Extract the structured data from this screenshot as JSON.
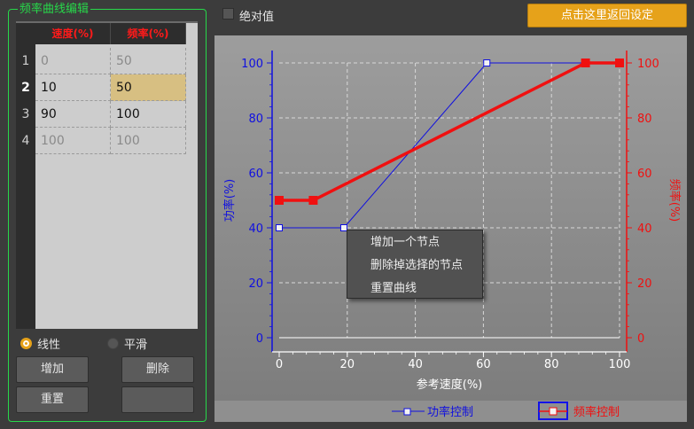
{
  "editor": {
    "group_title": "频率曲线编辑",
    "columns": [
      "速度(%)",
      "频率(%)"
    ],
    "rows": [
      {
        "index": "1",
        "speed": "0",
        "freq": "50"
      },
      {
        "index": "2",
        "speed": "10",
        "freq": "50"
      },
      {
        "index": "3",
        "speed": "90",
        "freq": "100"
      },
      {
        "index": "4",
        "speed": "100",
        "freq": "100"
      }
    ],
    "selected_row": 2,
    "radio_linear": "线性",
    "radio_smooth": "平滑",
    "selected_mode": "线性",
    "btn_add": "增加",
    "btn_delete": "删除",
    "btn_reset": "重置",
    "btn_blank": ""
  },
  "topbar": {
    "absolute_label": "绝对值",
    "absolute_checked": false,
    "reset_default": "点击这里返回设定"
  },
  "context_menu": {
    "items": [
      "增加一个节点",
      "删除掉选择的节点",
      "重置曲线"
    ]
  },
  "chart_data": {
    "type": "line",
    "xlabel": "参考速度(%)",
    "ylabel_left": "功率(%)",
    "ylabel_right": "频率(%)",
    "xlim": [
      0,
      100
    ],
    "ylim": [
      0,
      100
    ],
    "xticks": [
      0,
      20,
      40,
      60,
      80,
      100
    ],
    "yticks": [
      0,
      20,
      40,
      60,
      80,
      100
    ],
    "grid": true,
    "legend_position": "bottom",
    "series": [
      {
        "name": "功率控制",
        "color": "#1010e0",
        "axis": "left",
        "x": [
          0,
          19,
          61,
          100
        ],
        "y": [
          40,
          40,
          100,
          100
        ]
      },
      {
        "name": "频率控制",
        "color": "#f01010",
        "axis": "right",
        "x": [
          0,
          10,
          90,
          100
        ],
        "y": [
          50,
          50,
          100,
          100
        ]
      }
    ]
  }
}
